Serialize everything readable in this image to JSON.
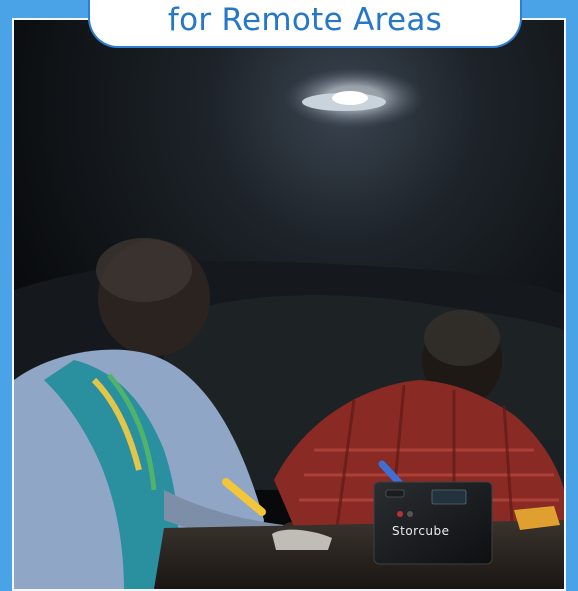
{
  "banner": {
    "title": "for Remote Areas"
  },
  "device": {
    "brand": "Storcube"
  },
  "colors": {
    "frame": "#4aa3e6",
    "banner_text": "#2477c9",
    "banner_border": "#2f7fd1"
  }
}
